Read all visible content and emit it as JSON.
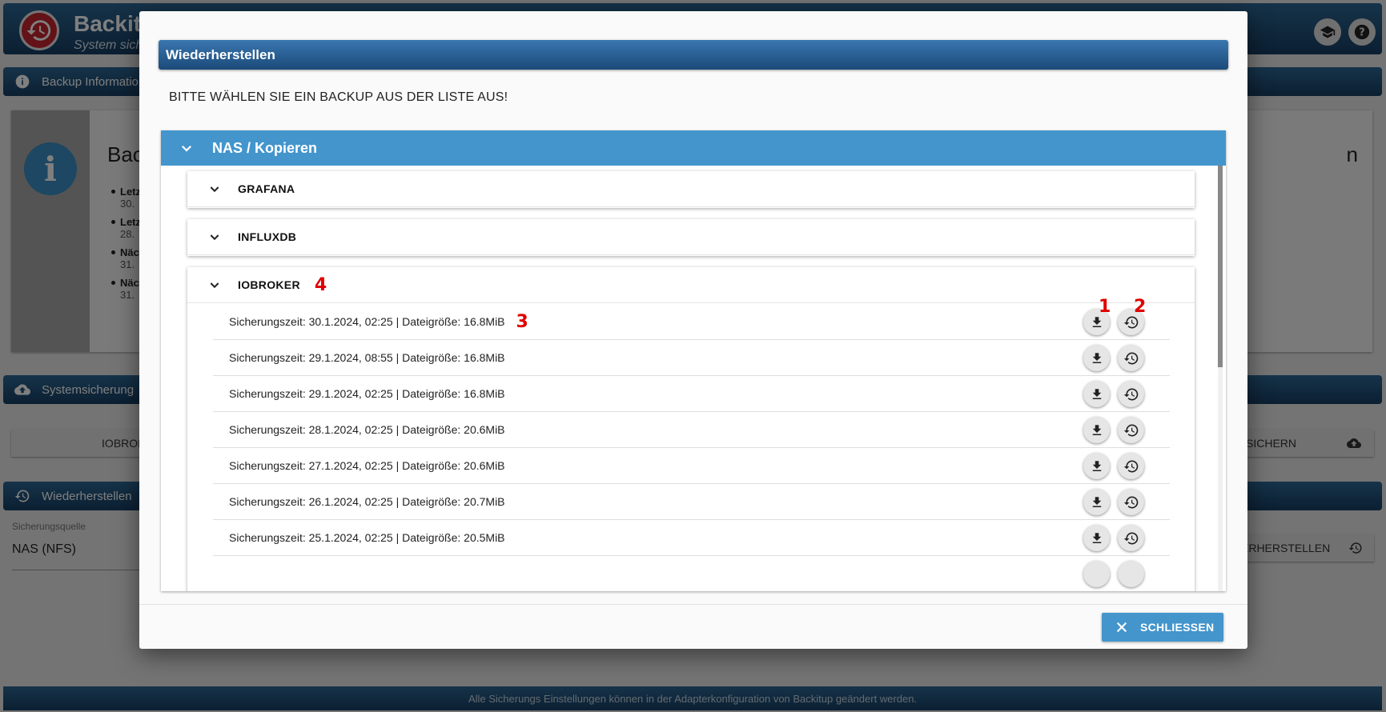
{
  "app": {
    "title": "Backitup",
    "subtitle": "System sichern"
  },
  "background": {
    "info_bar_label": "Backup Informationen",
    "info_heading_left": "Backup",
    "info_heading_right": "n",
    "info_items": [
      {
        "label": "Letzte",
        "value": "30."
      },
      {
        "label": "Letzte",
        "value": "28."
      },
      {
        "label": "Nächste",
        "value": "31."
      },
      {
        "label": "Nächste",
        "value": "31."
      }
    ],
    "backup_bar_label": "Systemsicherung",
    "backup_button_left": "IOBROKER",
    "backup_button_right": "SICHERN",
    "restore_bar_label": "Wiederherstellen",
    "source_label": "Sicherungsquelle",
    "source_value": "NAS (NFS)",
    "restore_button_right": "ERHERSTELLEN",
    "footer": "Alle Sicherungs Einstellungen können in der Adapterkonfiguration von Backitup geändert werden."
  },
  "dialog": {
    "title": "Wiederherstellen",
    "message": "BITTE WÄHLEN SIE EIN BACKUP AUS DER LISTE AUS!",
    "panel_title": "NAS / Kopieren",
    "groups": [
      {
        "name": "GRAFANA"
      },
      {
        "name": "INFLUXDB"
      },
      {
        "name": "IOBROKER",
        "marker": "4"
      }
    ],
    "backups": [
      {
        "text": "Sicherungszeit: 30.1.2024, 02:25 | Dateigröße: 16.8MiB",
        "marker": "3"
      },
      {
        "text": "Sicherungszeit: 29.1.2024, 08:55 | Dateigröße: 16.8MiB"
      },
      {
        "text": "Sicherungszeit: 29.1.2024, 02:25 | Dateigröße: 16.8MiB"
      },
      {
        "text": "Sicherungszeit: 28.1.2024, 02:25 | Dateigröße: 20.6MiB"
      },
      {
        "text": "Sicherungszeit: 27.1.2024, 02:25 | Dateigröße: 20.6MiB"
      },
      {
        "text": "Sicherungszeit: 26.1.2024, 02:25 | Dateigröße: 20.7MiB"
      },
      {
        "text": "Sicherungszeit: 25.1.2024, 02:25 | Dateigröße: 20.5MiB"
      }
    ],
    "column_markers": {
      "download": "1",
      "restore": "2"
    },
    "close_label": "SCHLIESSEN"
  },
  "colors": {
    "header_blue": "#1b4a79",
    "accent_blue": "#4395cc",
    "annotation_red": "#e00000",
    "logo_red": "#c6242f"
  },
  "icons": [
    "history-logo-icon",
    "graduation-cap-icon",
    "help-icon",
    "info-icon",
    "cloud-upload-icon",
    "history-icon",
    "chevron-down-icon",
    "download-icon",
    "restore-icon",
    "close-icon"
  ]
}
